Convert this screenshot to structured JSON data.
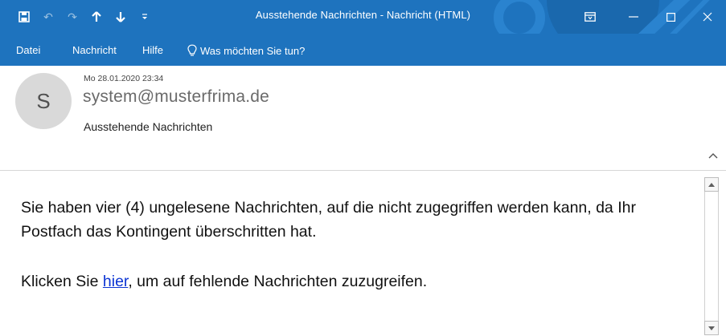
{
  "window": {
    "title": "Ausstehende Nachrichten  -  Nachricht (HTML)"
  },
  "quick_access": {
    "icons": [
      "save-icon",
      "undo-icon",
      "redo-icon",
      "arrow-up-icon",
      "arrow-down-icon",
      "customize-icon"
    ]
  },
  "menu": {
    "items": [
      "Datei",
      "Nachricht",
      "Hilfe"
    ],
    "tell_me": "Was möchten Sie tun?"
  },
  "message": {
    "date": "Mo 28.01.2020 23:34",
    "avatar_initial": "S",
    "from": "system@musterfrima.de",
    "subject": "Ausstehende Nachrichten",
    "body_line1": "Sie haben vier (4) ungelesene Nachrichten, auf die nicht zugegriffen werden kann, da Ihr Postfach das Kontingent überschritten hat.",
    "body_line2_before": "Klicken Sie ",
    "body_link": "hier",
    "body_line2_after": ", um auf fehlende Nachrichten zuzugreifen."
  },
  "colors": {
    "titlebar": "#1e73be",
    "link": "#0b34d3",
    "avatar_bg": "#d9d9d9"
  }
}
